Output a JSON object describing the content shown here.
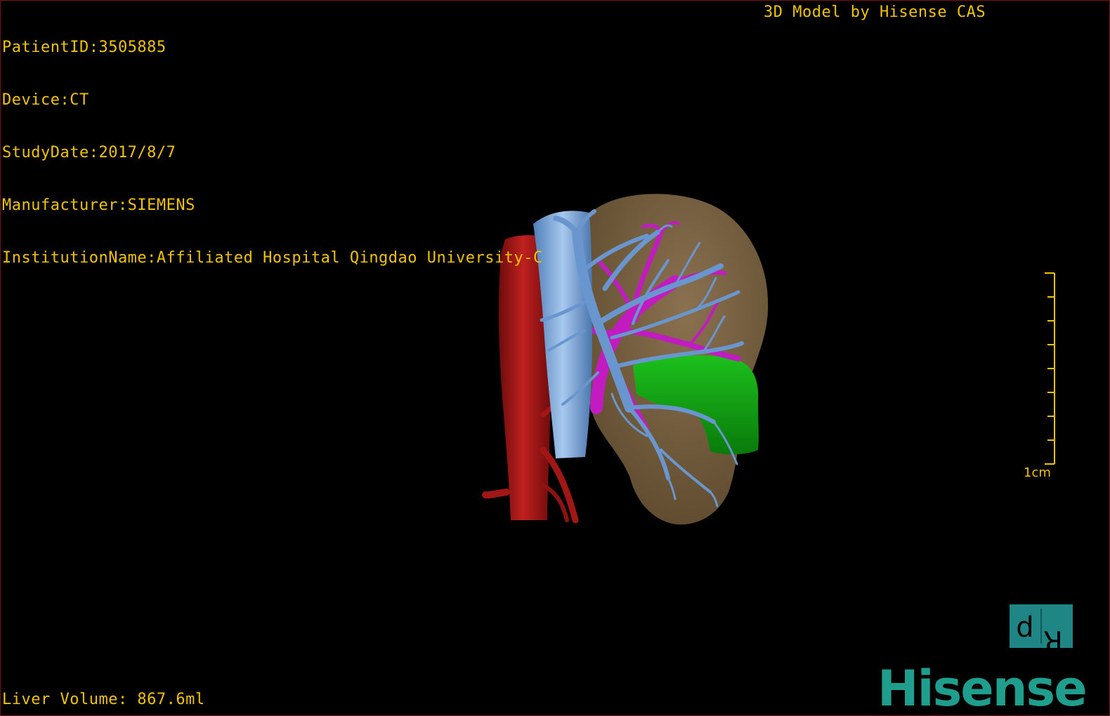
{
  "patient": {
    "id_line": "PatientID:3505885",
    "device_line": "Device:CT",
    "study_date_line": "StudyDate:2017/8/7",
    "manufacturer_line": "Manufacturer:SIEMENS",
    "institution_line": "InstitutionName:Affiliated Hospital Qingdao University-C"
  },
  "header": {
    "model_credit": "3D Model by Hisense CAS"
  },
  "footer": {
    "liver_volume": "Liver Volume: 867.6ml"
  },
  "scale": {
    "label": "1cm"
  },
  "orientation": {
    "left_glyph": "d",
    "right_glyph": "R"
  },
  "brand": {
    "logo_text": "Hisense"
  },
  "colors": {
    "overlay_text": "#f0c400",
    "liver": "#7a6341",
    "aorta": "#a31616",
    "vena_cava": "#7aa6d9",
    "hepatic_vein": "#6a96cf",
    "portal_vein": "#c21bc2",
    "gallbladder_duct": "#12a012",
    "brand": "#1f9e8e"
  }
}
